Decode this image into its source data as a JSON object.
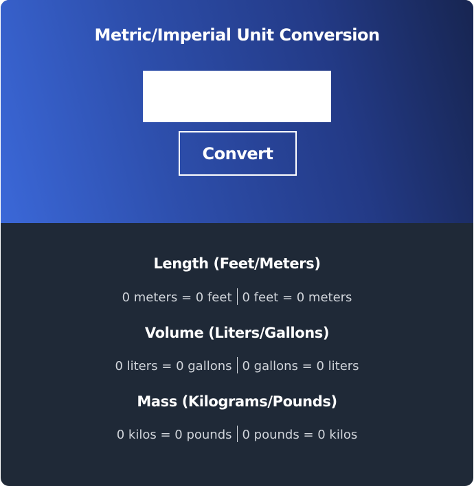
{
  "header": {
    "title": "Metric/Imperial Unit Conversion",
    "input_value": "",
    "input_placeholder": "",
    "convert_label": "Convert"
  },
  "sections": [
    {
      "title": "Length (Feet/Meters)",
      "left": "0 meters = 0 feet",
      "right": "0 feet = 0 meters"
    },
    {
      "title": "Volume (Liters/Gallons)",
      "left": "0 liters = 0 gallons",
      "right": "0 gallons = 0 liters"
    },
    {
      "title": "Mass (Kilograms/Pounds)",
      "left": "0 kilos = 0 pounds",
      "right": "0 pounds = 0 kilos"
    }
  ],
  "colors": {
    "gradient_start": "#3b68d8",
    "gradient_end": "#172551",
    "results_background": "#1f2937",
    "title_text": "#ffffff",
    "result_text": "#d1d5db"
  }
}
